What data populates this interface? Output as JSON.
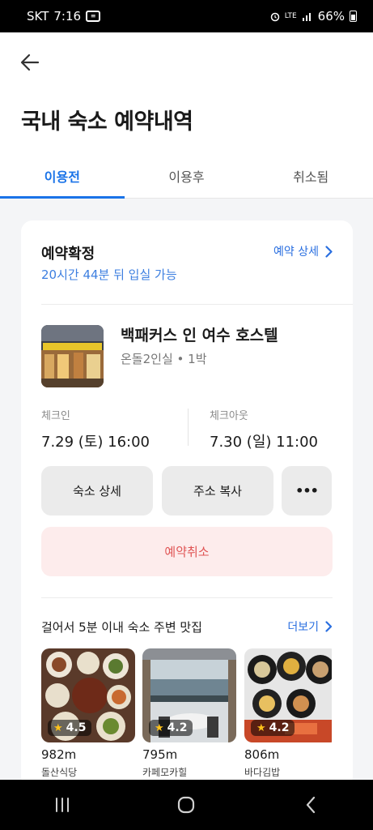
{
  "status_bar": {
    "carrier": "SKT",
    "time": "7:16",
    "network": "LTE",
    "battery": "66%"
  },
  "header": {
    "title": "국내 숙소 예약내역",
    "tabs": [
      {
        "label": "이용전"
      },
      {
        "label": "이용후"
      },
      {
        "label": "취소됨"
      }
    ]
  },
  "reservation": {
    "status": "예약확정",
    "checkin_notice": "20시간 44분 뒤 입실 가능",
    "detail_link": "예약 상세",
    "hotel_name": "백패커스 인 여수 호스텔",
    "room_type": "온돌2인실",
    "nights": "1박",
    "checkin_label": "체크인",
    "checkin_value": "7.29 (토) 16:00",
    "checkout_label": "체크아웃",
    "checkout_value": "7.30 (일) 11:00",
    "buttons": {
      "detail": "숙소 상세",
      "copy_address": "주소 복사",
      "more": "•••"
    },
    "cancel_label": "예약취소"
  },
  "nearby": {
    "title": "걸어서 5분 이내 숙소 주변 맛집",
    "more_link": "더보기",
    "items": [
      {
        "rating": "4.5",
        "distance": "982m",
        "name": "돌산식당"
      },
      {
        "rating": "4.2",
        "distance": "795m",
        "name": "카페모카힐"
      },
      {
        "rating": "4.2",
        "distance": "806m",
        "name": "바다김밥"
      }
    ]
  },
  "colors": {
    "accent": "#1a73e8",
    "cancel_bg": "#fdecec",
    "cancel_text": "#e05555",
    "star": "#ffc21a"
  }
}
